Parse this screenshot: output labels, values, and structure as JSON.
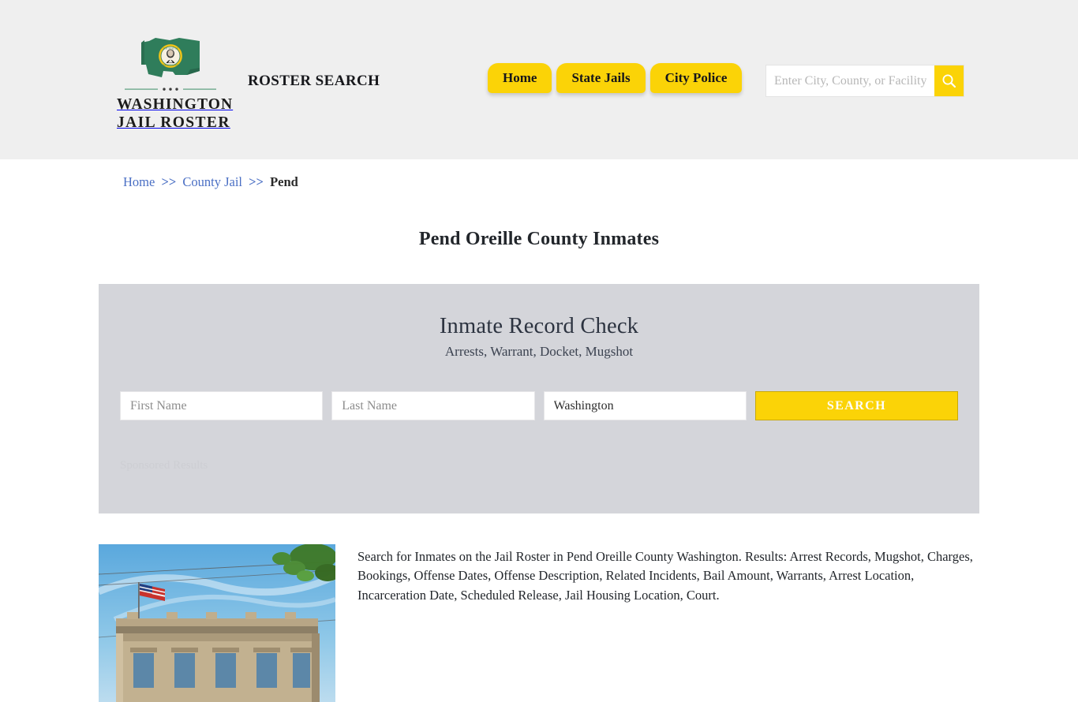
{
  "header": {
    "brand": {
      "line1": "WASHINGTON",
      "line2": "JAIL ROSTER",
      "logo_icon": "washington-state-flag-seal-icon",
      "divider_icon": "ornament-divider-icon"
    },
    "tagline": "ROSTER SEARCH",
    "nav": [
      {
        "label": "Home",
        "name": "nav-home"
      },
      {
        "label": "State Jails",
        "name": "nav-state-jails"
      },
      {
        "label": "City Police",
        "name": "nav-city-police"
      }
    ],
    "search": {
      "placeholder": "Enter City, County, or Facility Name",
      "value": "",
      "button_icon": "search-icon"
    },
    "background_color": "#efefef"
  },
  "breadcrumb": {
    "items": [
      {
        "label": "Home",
        "link": true
      },
      {
        "label": "County Jail",
        "link": true
      },
      {
        "label": "Pend",
        "link": false
      }
    ],
    "separator": ">>"
  },
  "page": {
    "title": "Pend Oreille County Inmates"
  },
  "record_check": {
    "title": "Inmate Record Check",
    "subtitle": "Arrests, Warrant, Docket, Mugshot",
    "first_name_placeholder": "First Name",
    "first_name_value": "",
    "last_name_placeholder": "Last Name",
    "last_name_value": "",
    "state_selected": "Washington",
    "state_options": [
      "Washington"
    ],
    "search_button": "SEARCH",
    "sponsored_label": "Sponsored Results",
    "panel_color": "#d4d5da"
  },
  "content": {
    "photo_alt": "county-courthouse-with-american-flag-photo",
    "description": "Search for Inmates on the Jail Roster in Pend Oreille County Washington. Results: Arrest Records, Mugshot, Charges, Bookings, Offense Dates, Offense Description, Related Incidents, Bail Amount, Warrants, Arrest Location, Incarceration Date, Scheduled Release, Jail Housing Location, Court."
  },
  "colors": {
    "accent_yellow": "#fbd307",
    "link_blue": "#4a6fc4",
    "brand_green": "#2e7d5b"
  }
}
